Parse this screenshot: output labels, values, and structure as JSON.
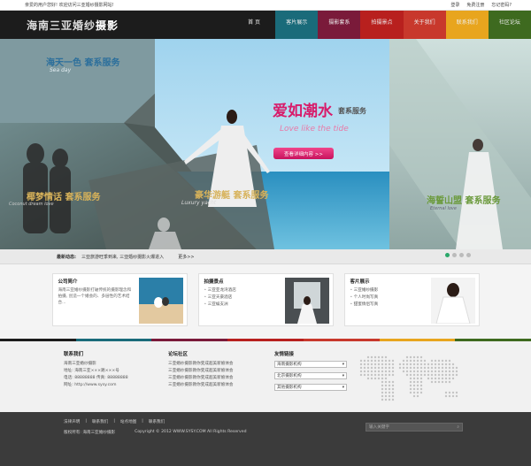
{
  "topbar": {
    "welcome": "亲爱的用户您好! 欢迎访问三亚婚纱摄影网站!",
    "links": [
      "登录",
      "免费注册",
      "忘记密码?"
    ]
  },
  "header": {
    "logo_light": "海南三亚婚纱",
    "logo_strong": "摄影",
    "nav": [
      {
        "label": "首 页",
        "color": "#1c1c1c"
      },
      {
        "label": "客片展示",
        "color": "#1a6b7a"
      },
      {
        "label": "摄影套系",
        "color": "#7a1a3a"
      },
      {
        "label": "拍摄景点",
        "color": "#b8201e"
      },
      {
        "label": "关于我们",
        "color": "#c8382c"
      },
      {
        "label": "联系我们",
        "color": "#e8a51e"
      },
      {
        "label": "社区论坛",
        "color": "#3e6a1f"
      }
    ]
  },
  "banner": {
    "left_top": "海天一色 套系服务",
    "left_top_en": "Sea day",
    "left_bottom": "椰梦情话 套系服务",
    "left_bottom_en": "Coconut dream love",
    "mid_bottom": "豪华游艇 套系服务",
    "mid_bottom_en": "Luxury yacht",
    "main": "爱如潮水",
    "main_suffix": "套系服务",
    "main_en": "Love like the tide",
    "cta": "查看详细内容 >>",
    "right": "海誓山盟 套系服务",
    "right_en": "Eternal love"
  },
  "news": {
    "label": "最新动态:",
    "text": "三亚旅游旺季到来, 三亚婚纱摄影火爆进入",
    "more": "更多>>"
  },
  "features": [
    {
      "title": "公司简介",
      "desc": "海南三亚婚纱摄影打破传统的摄影理念和拍摄, 创造一个婚会的、多层性的艺术结合...",
      "items": []
    },
    {
      "title": "拍摄景点",
      "desc": "",
      "items": [
        "三亚亚龙湾酒店",
        "三亚天豪酒店",
        "三亚蜈支洲"
      ]
    },
    {
      "title": "客片展示",
      "desc": "",
      "items": [
        "三亚婚纱摄影",
        "个人时尚写真",
        "甜蜜情侣写真"
      ]
    }
  ],
  "stripe_colors": [
    "#1c1c1c",
    "#1a6b7a",
    "#7a1a3a",
    "#b8201e",
    "#c8382c",
    "#e8a51e",
    "#3e6a1f"
  ],
  "contact": {
    "title": "联系我们",
    "lines": [
      "海南三亚婚纱摄影",
      "地址: 海南三亚×××路×××号",
      "电话: 88888888    传真: 88888888",
      "网址: http://www.sysy.com"
    ]
  },
  "forum": {
    "title": "论坛社区",
    "lines": [
      "三亚婚纱摄影教你变成超美新娘体会",
      "三亚婚纱摄影教你变成超美新娘体会",
      "三亚婚纱摄影教你变成超美新娘体会",
      "三亚婚纱摄影教你变成超美新娘体会"
    ]
  },
  "friends": {
    "title": "友情链接",
    "selects": [
      "海南摄影机构",
      "北京摄影机构",
      "其他摄影机构"
    ]
  },
  "footer": {
    "links": [
      "法律声明",
      "联系我们",
      "站点地图",
      "联系我们"
    ],
    "copy_left": "版权所有: 海南三亚婚纱摄影",
    "copy_right": "Copyright © 2012  WWW.SYSY.COM  All Rights Reserved",
    "search_placeholder": "输入关键字"
  }
}
